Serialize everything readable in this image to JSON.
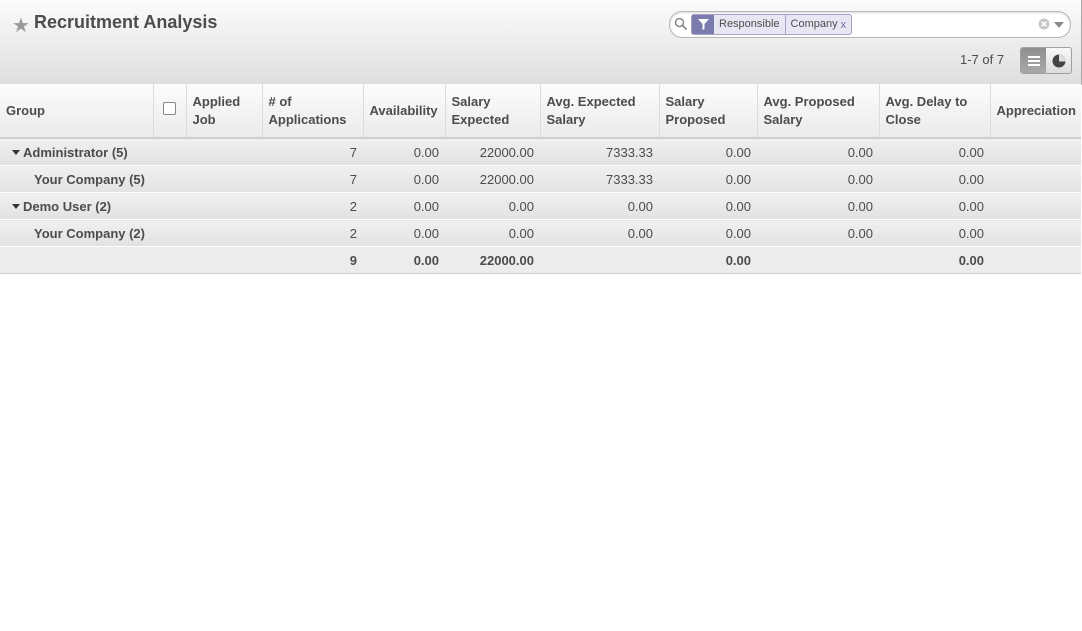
{
  "header": {
    "title": "Recruitment Analysis",
    "search": {
      "facet_values": [
        "Responsible",
        "Company"
      ],
      "facet_close": "x"
    },
    "pager": "1-7 of 7"
  },
  "table": {
    "columns": [
      "Group",
      "",
      "Applied Job",
      "# of Applications",
      "Availability",
      "Salary Expected",
      "Avg. Expected Salary",
      "Salary Proposed",
      "Avg. Proposed Salary",
      "Avg. Delay to Close",
      "Appreciation"
    ],
    "rows": [
      {
        "label": "Administrator (5)",
        "applied_job": "",
        "applications": "7",
        "availability": "0.00",
        "salary_expected": "22000.00",
        "avg_expected": "7333.33",
        "salary_proposed": "0.00",
        "avg_proposed": "0.00",
        "avg_delay": "0.00",
        "appreciation": ""
      },
      {
        "label": "Your Company (5)",
        "applied_job": "",
        "applications": "7",
        "availability": "0.00",
        "salary_expected": "22000.00",
        "avg_expected": "7333.33",
        "salary_proposed": "0.00",
        "avg_proposed": "0.00",
        "avg_delay": "0.00",
        "appreciation": ""
      },
      {
        "label": "Demo User (2)",
        "applied_job": "",
        "applications": "2",
        "availability": "0.00",
        "salary_expected": "0.00",
        "avg_expected": "0.00",
        "salary_proposed": "0.00",
        "avg_proposed": "0.00",
        "avg_delay": "0.00",
        "appreciation": ""
      },
      {
        "label": "Your Company (2)",
        "applied_job": "",
        "applications": "2",
        "availability": "0.00",
        "salary_expected": "0.00",
        "avg_expected": "0.00",
        "salary_proposed": "0.00",
        "avg_proposed": "0.00",
        "avg_delay": "0.00",
        "appreciation": ""
      }
    ],
    "totals": {
      "applications": "9",
      "availability": "0.00",
      "salary_expected": "22000.00",
      "avg_expected": "",
      "salary_proposed": "0.00",
      "avg_proposed": "",
      "avg_delay": "0.00",
      "appreciation": ""
    }
  },
  "colors": {
    "facet_bg": "#7c7bad",
    "header_text": "#4c4c4c"
  },
  "icons": [
    "star-icon",
    "search-icon",
    "filter-icon",
    "clear-search-icon",
    "dropdown-icon",
    "list-view-icon",
    "graph-view-icon"
  ]
}
